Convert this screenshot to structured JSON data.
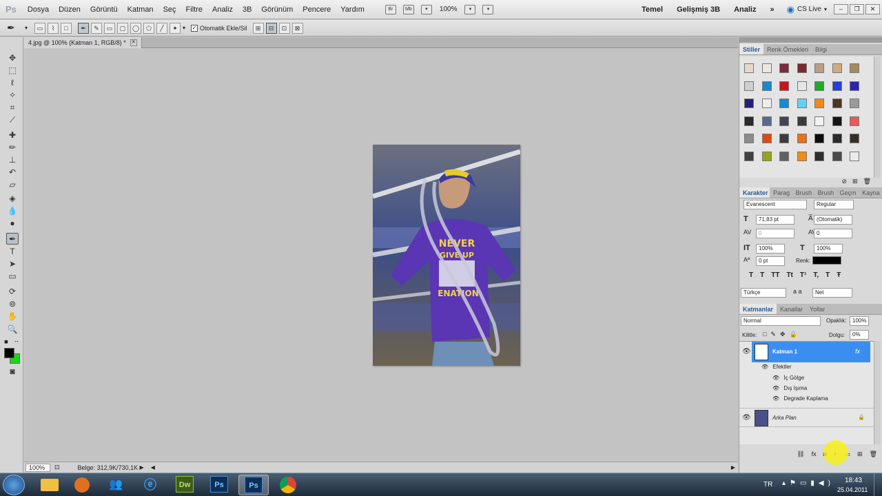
{
  "app": {
    "logo": "Ps"
  },
  "menu": [
    "Dosya",
    "Düzen",
    "Görüntü",
    "Katman",
    "Seç",
    "Filtre",
    "Analiz",
    "3B",
    "Görünüm",
    "Pencere",
    "Yardım"
  ],
  "menubar": {
    "bridge_btn": "Br",
    "minibridge_btn": "Mb",
    "zoom": "100%",
    "workspaces": [
      "Temel",
      "Gelişmiş 3B",
      "Analiz"
    ],
    "more": "»",
    "cslive": "CS Live"
  },
  "options": {
    "auto_add_delete": "Otomatik Ekle/Sil"
  },
  "document": {
    "tab_title": "4.jpg @ 100% (Katman 1, RGB/8) *"
  },
  "status": {
    "zoom": "100%",
    "doc_size": "Belge: 312,9K/730,1K"
  },
  "styles_panel": {
    "tabs": [
      "Stiller",
      "Renk Örnekleri",
      "Bilgi"
    ],
    "swatches": [
      [
        "#e7d8c8",
        "#ebe8df",
        "#7b2b3f",
        "#7a2a2a",
        "#b89e86",
        "#cfab80",
        "#a38a5f"
      ],
      [
        "#cfcfcf",
        "#1f86c9",
        "#c8141b",
        "#e6e6e6",
        "#1faa2a",
        "#2340d8",
        "#2a22b8"
      ],
      [
        "#24207a",
        "#efefef",
        "#168cd0",
        "#66d0f2",
        "#ef8a14",
        "#4a3624",
        "#9a9a9a"
      ],
      [
        "#2a2a2a",
        "#5a6a8a",
        "#434358",
        "#3a3a3a",
        "#f2f2f2",
        "#151515",
        "#e85a5a"
      ],
      [
        "#8c8c8c",
        "#dc4a14",
        "#3c3c3c",
        "#e8701a",
        "#0c0c0c",
        "#2a2a2a",
        "#3a2e22"
      ],
      [
        "#404040",
        "#96a41c",
        "#606060",
        "#f08c1a",
        "#2e2e2e",
        "#4a4a4a",
        "#eaeaea"
      ]
    ]
  },
  "character_panel": {
    "tabs": [
      "Karakter",
      "Parag",
      "Brush",
      "Brush",
      "Geçm",
      "Kayna"
    ],
    "font": "Evanescent",
    "style": "Regular",
    "size": "71,83 pt",
    "leading": "(Otomatik)",
    "kerning": "0",
    "tracking": "0",
    "vscale": "100%",
    "hscale": "100%",
    "baseline": "0 pt",
    "color_label": "Renk:",
    "color": "#000000",
    "language": "Türkçe",
    "aa_label": "a a",
    "antialias": "Net",
    "type_buttons": [
      "T",
      "T",
      "TT",
      "Tt",
      "T¹",
      "T,",
      "T",
      "Ŧ"
    ]
  },
  "layers_panel": {
    "tabs": [
      "Katmanlar",
      "Kanallar",
      "Yollar"
    ],
    "blend_mode": "Normal",
    "opacity_label": "Opaklık:",
    "opacity": "100%",
    "lock_label": "Kilitle:",
    "fill_label": "Dolgu:",
    "fill": "0%",
    "fx_label": "fx",
    "layers": [
      {
        "name": "Katman 1",
        "selected": true
      },
      {
        "name": "Arka Plan",
        "selected": false
      }
    ],
    "effects_label": "Efektler",
    "effects": [
      "İç Gölge",
      "Dış Işıma",
      "Degrade Kaplama"
    ],
    "footer_icons": [
      "link-icon",
      "fx-icon",
      "mask-icon",
      "adjustment-icon",
      "folder-icon",
      "new-layer-icon",
      "trash-icon"
    ]
  },
  "colors": {
    "foreground": "#000000",
    "background": "#1fd41f",
    "layer_selected": "#3a8ef2"
  },
  "taskbar": {
    "apps": [
      "start",
      "explorer",
      "media-player",
      "messenger",
      "ie",
      "dreamweaver",
      "photoshop",
      "photoshop",
      "chrome"
    ],
    "dw": "Dw",
    "ps": "Ps",
    "lang": "TR",
    "time": "18:43",
    "date": "25.04.2011"
  }
}
